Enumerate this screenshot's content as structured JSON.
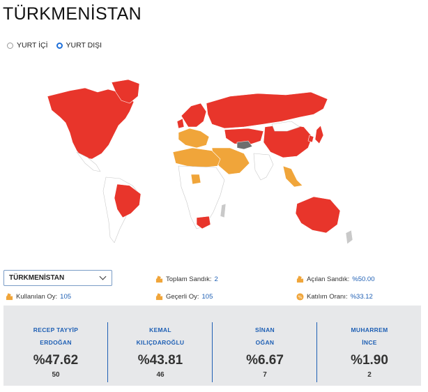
{
  "page": {
    "title": "TÜRKMENİSTAN"
  },
  "filters": {
    "options": [
      {
        "label": "YURT İÇİ",
        "selected": false
      },
      {
        "label": "YURT DIŞI",
        "selected": true
      }
    ]
  },
  "country_select": {
    "value": "TÜRKMENİSTAN"
  },
  "stats": {
    "toplam_sandik": {
      "label": "Toplam Sandık:",
      "value": "2"
    },
    "acilan_sandik": {
      "label": "Açılan Sandık:",
      "value": "%50.00"
    },
    "kullanilan_oy": {
      "label": "Kullanılan Oy:",
      "value": "105"
    },
    "gecerli_oy": {
      "label": "Geçerli Oy:",
      "value": "105"
    },
    "katilim_orani": {
      "label": "Katılım Oranı:",
      "value": "%33.12"
    }
  },
  "candidates": [
    {
      "first": "RECEP TAYYİP",
      "last": "ERDOĞAN",
      "percent": "%47.62",
      "votes": "50"
    },
    {
      "first": "KEMAL",
      "last": "KILIÇDAROĞLU",
      "percent": "%43.81",
      "votes": "46"
    },
    {
      "first": "SİNAN",
      "last": "OĞAN",
      "percent": "%6.67",
      "votes": "7"
    },
    {
      "first": "MUHARREM",
      "last": "İNCE",
      "percent": "%1.90",
      "votes": "2"
    }
  ],
  "colors": {
    "red": "#e8352b",
    "orange": "#f0a53a",
    "grey": "#c9c9c9",
    "dark_grey": "#6e6e6e",
    "accent": "#1e5fb4"
  },
  "icons": {
    "stat_box": "ballot-box-icon",
    "stat_percent": "percent-circle-icon",
    "select": "chevron-down-icon"
  }
}
